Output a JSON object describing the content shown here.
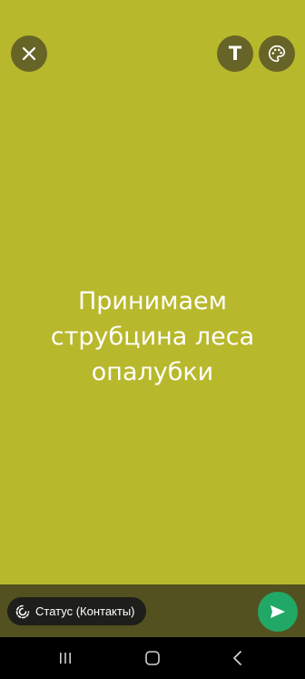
{
  "status_text": {
    "lines": [
      "Принимаем",
      "струбцина леса",
      "опалубки"
    ]
  },
  "colors": {
    "background": "#b8b82c",
    "control_bg": "#676427",
    "bottom_bar": "#52511f",
    "send_button": "#22a866",
    "text": "#ffffff"
  },
  "toolbar": {
    "close_icon": "close-icon",
    "text_icon": "text-format-icon",
    "text_glyph": "T",
    "palette_icon": "palette-icon"
  },
  "composer": {
    "audience_label": "Статус (Контакты)",
    "audience_icon": "status-icon",
    "send_icon": "send-icon"
  },
  "navigation": {
    "recents_icon": "recents-icon",
    "home_icon": "home-icon",
    "back_icon": "back-icon"
  }
}
